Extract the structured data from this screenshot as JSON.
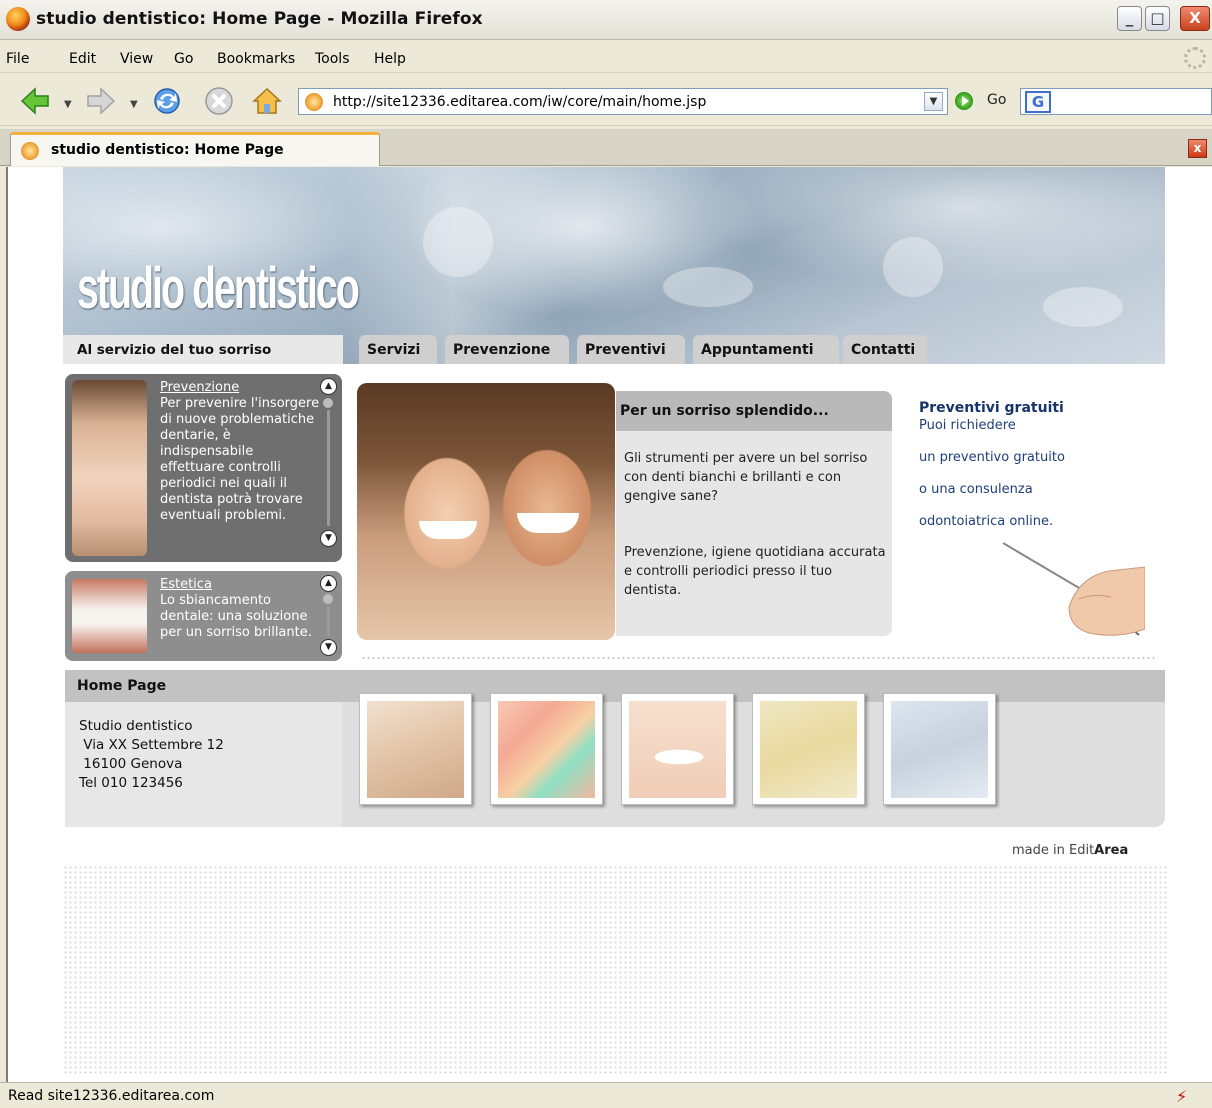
{
  "window": {
    "title": "studio dentistico: Home Page - Mozilla Firefox",
    "controls": {
      "minimize": "_",
      "maximize": "□",
      "close": "X"
    }
  },
  "menu": [
    "File",
    "Edit",
    "View",
    "Go",
    "Bookmarks",
    "Tools",
    "Help"
  ],
  "toolbar": {
    "back_icon": "back-arrow-icon",
    "forward_icon": "forward-arrow-icon",
    "reload_icon": "reload-icon",
    "stop_icon": "stop-icon",
    "home_icon": "home-icon",
    "url": "http://site12336.editarea.com/iw/core/main/home.jsp",
    "go_label": "Go",
    "search_engine": "G"
  },
  "tab": {
    "label": "studio dentistico: Home Page",
    "close": "x"
  },
  "status": {
    "text": "Read site12336.editarea.com"
  },
  "site": {
    "logo": "studio dentistico",
    "tagline": "Al servizio del tuo sorriso",
    "nav": [
      "Servizi",
      "Prevenzione",
      "Preventivi",
      "Appuntamenti",
      "Contatti"
    ],
    "box1": {
      "title": "Prevenzione",
      "text": "Per prevenire l'insorgere di nuove problematiche dentarie, è indispensabile effettuare controlli periodici nei quali il dentista potrà trovare eventuali problemi."
    },
    "box2": {
      "title": "Estetica",
      "text": "Lo sbiancamento dentale: una soluzione per un sorriso brillante."
    },
    "home": {
      "title": "Home Page",
      "address": [
        "Studio dentistico",
        " Via XX Settembre 12",
        " 16100 Genova",
        "Tel 010 123456"
      ]
    },
    "feature": {
      "title": "Per un sorriso splendido...",
      "p1": "Gli strumenti per avere un bel sorriso con denti bianchi e brillanti e con gengive sane?",
      "p2": "Prevenzione, igiene quotidiana accurata e controlli periodici presso il tuo dentista."
    },
    "promo": {
      "title": "Preventivi gratuiti",
      "lines": [
        "Puoi richiedere",
        "un preventivo gratuito",
        "o una consulenza",
        "odontoiatrica online."
      ]
    },
    "made_prefix": "made in Edit",
    "made_brand": "Area"
  }
}
